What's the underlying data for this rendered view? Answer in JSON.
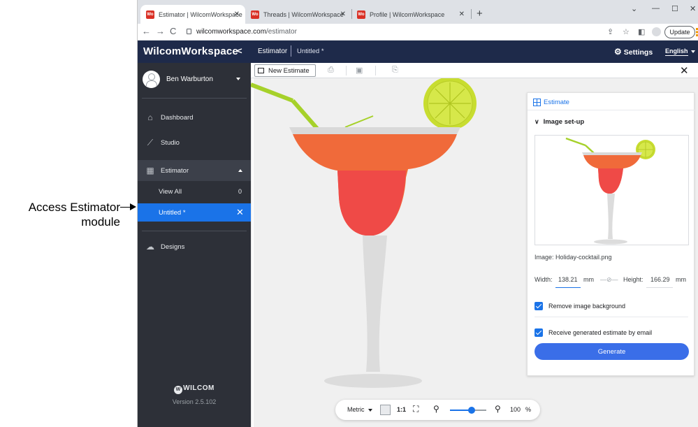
{
  "annotation": {
    "line1": "Access Estimator",
    "line2": "module"
  },
  "browser": {
    "tabs": [
      {
        "title": "Estimator | WilcomWorkspace",
        "active": true
      },
      {
        "title": "Threads | WilcomWorkspace",
        "active": false
      },
      {
        "title": "Profile | WilcomWorkspace",
        "active": false
      }
    ],
    "favicon_text": "Wo",
    "url_host": "wilcomworkspace.com",
    "url_path": "/estimator",
    "update_label": "Update"
  },
  "sidebar": {
    "brand": "WilcomWorkspace",
    "user_name": "Ben Warburton",
    "items": [
      {
        "label": "Dashboard",
        "icon": "home-icon"
      },
      {
        "label": "Studio",
        "icon": "chart-icon"
      },
      {
        "label": "Estimator",
        "icon": "estimator-icon"
      },
      {
        "label": "Designs",
        "icon": "cloud-icon"
      }
    ],
    "sub_items": [
      {
        "label": "View All",
        "count": "0"
      },
      {
        "label": "Untitled *"
      }
    ],
    "logo_text": "WILCOM",
    "version": "Version 2.5.102"
  },
  "topbar": {
    "crumb_module": "Estimator",
    "crumb_doc": "Untitled *",
    "settings_label": "Settings",
    "language": "English"
  },
  "toolbar": {
    "new_estimate_label": "New Estimate"
  },
  "panel": {
    "title": "Estimate",
    "section_title": "Image set-up",
    "image_name": "Image: Holiday-cocktail.png",
    "width_label": "Width:",
    "width_value": "138.21",
    "width_unit": "mm",
    "height_label": "Height:",
    "height_value": "166.29",
    "height_unit": "mm",
    "remove_bg_label": "Remove image background",
    "email_label": "Receive generated estimate by email",
    "generate_label": "Generate"
  },
  "zoombar": {
    "units": "Metric",
    "one_to_one": "1:1",
    "zoom_value": "100",
    "zoom_unit": "%",
    "zoom_level": 0.6
  },
  "colors": {
    "sidebar_bg": "#2d3038",
    "header_bg": "#1e2a4a",
    "accent": "#1a73e8",
    "generate_bg": "#3a6ee8"
  }
}
